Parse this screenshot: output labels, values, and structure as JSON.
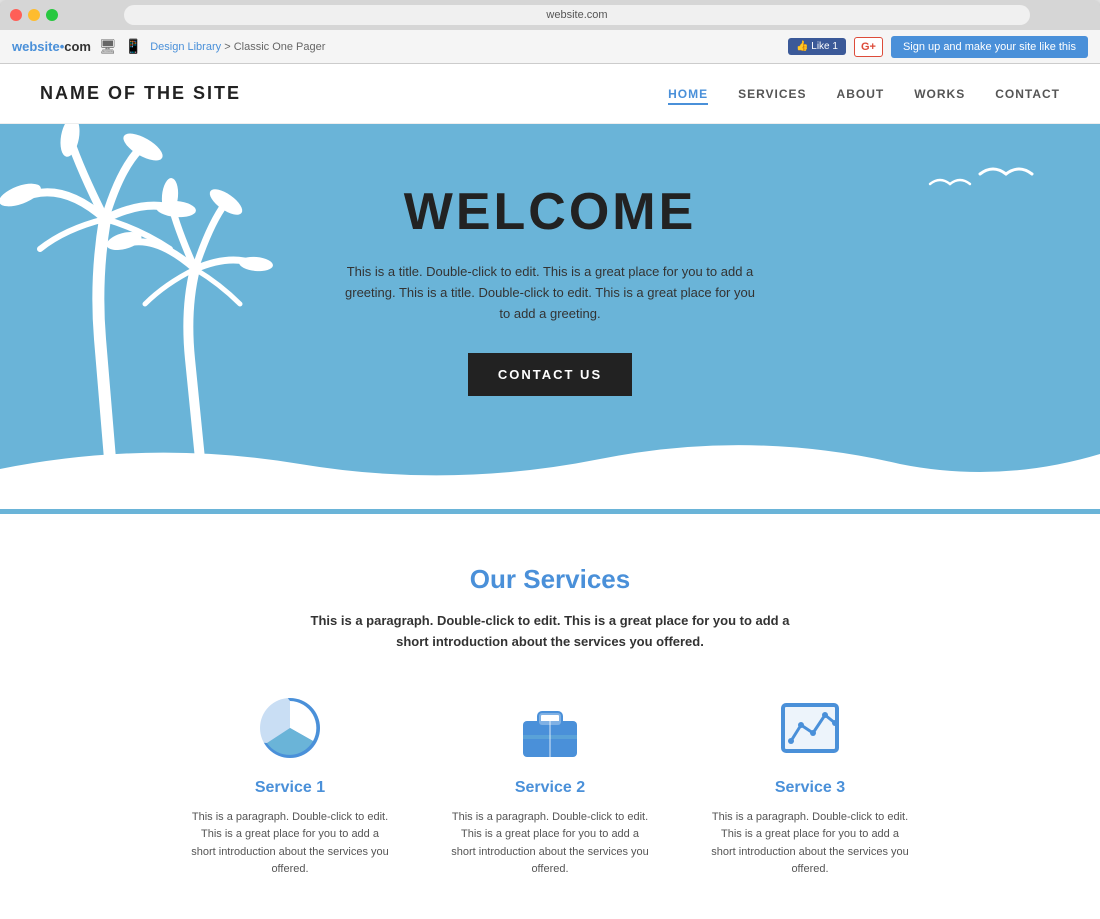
{
  "browser": {
    "address": "website.com",
    "logo": "website",
    "logo_dot": "•",
    "breadcrumb_link": "Design Library",
    "breadcrumb_separator": ">",
    "breadcrumb_current": "Classic One Pager",
    "fb_label": "👍 Like 1",
    "gplus_label": "G+",
    "signup_label": "Sign up and make your site like this"
  },
  "site": {
    "title": "NAME OF THE SITE",
    "nav": {
      "items": [
        {
          "label": "HOME",
          "active": true
        },
        {
          "label": "SERVICES",
          "active": false
        },
        {
          "label": "ABOUT",
          "active": false
        },
        {
          "label": "WORKS",
          "active": false
        },
        {
          "label": "CONTACT",
          "active": false
        }
      ]
    },
    "hero": {
      "title": "WELCOME",
      "subtitle": "This is a title. Double-click to edit. This is a great place for you to add a greeting. This is a title. Double-click to edit. This is a great place for you to add a greeting.",
      "cta_label": "CONTACT US"
    },
    "services": {
      "section_title": "Our Services",
      "intro": "This is a paragraph. Double-click to edit. This is a great place for you to add a short introduction about the services you offered.",
      "items": [
        {
          "name": "Service 1",
          "icon": "pie-chart",
          "description": "This is a paragraph. Double-click to edit. This is a great place for you to add a short introduction about the services you offered."
        },
        {
          "name": "Service 2",
          "icon": "briefcase",
          "description": "This is a paragraph. Double-click to edit. This is a great place for you to add a short introduction about the services you offered."
        },
        {
          "name": "Service 3",
          "icon": "chart",
          "description": "This is a paragraph. Double-click to edit. This is a great place for you to add a short introduction about the services you offered."
        }
      ]
    }
  },
  "colors": {
    "accent": "#4a90d9",
    "hero_bg": "#6ab4d8",
    "dark": "#222222",
    "text": "#555555"
  }
}
